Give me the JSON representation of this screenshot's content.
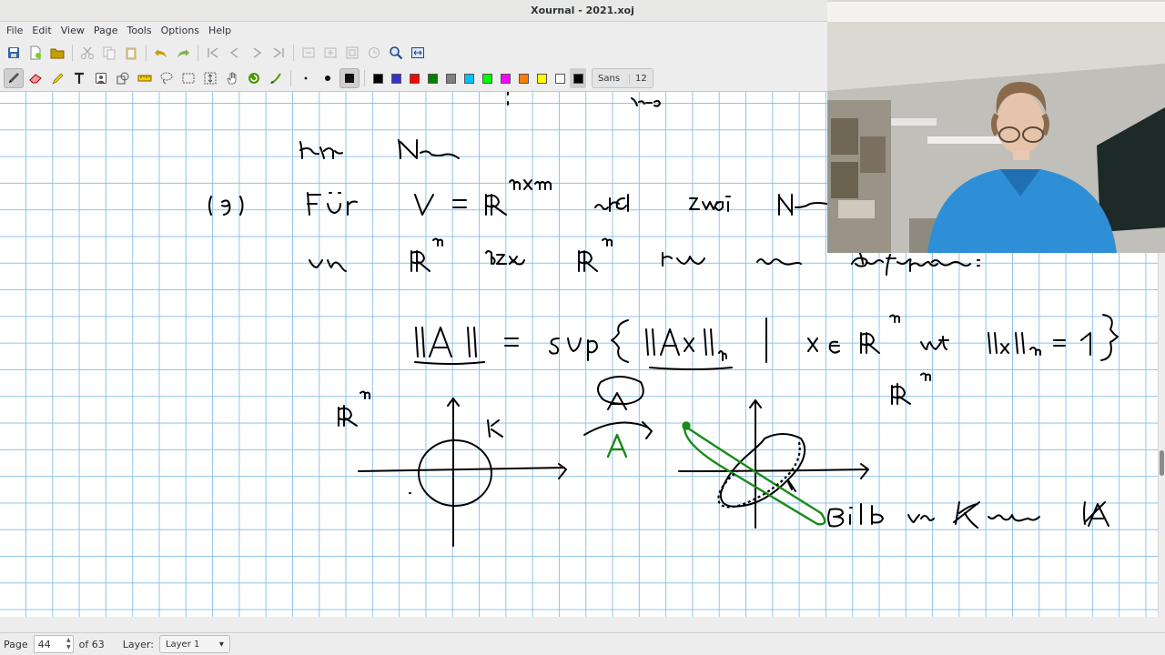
{
  "window": {
    "title": "Xournal - 2021.xoj"
  },
  "menu": [
    "File",
    "Edit",
    "View",
    "Page",
    "Tools",
    "Options",
    "Help"
  ],
  "toolbar1": [
    "save-icon",
    "new-page-icon",
    "open-icon",
    "cut-icon",
    "copy-icon",
    "paste-icon",
    "undo-icon",
    "redo-icon",
    "first-page-icon",
    "previous-page-icon",
    "next-page-icon",
    "last-page-icon",
    "zoom-icons",
    "zoom-fit-icon",
    "fullscreen-icon"
  ],
  "toolbar2": {
    "tools": [
      "pen-icon",
      "eraser-icon",
      "highlighter-icon",
      "text-icon",
      "image-icon",
      "shape-icon",
      "ruler-icon",
      "lasso-select-icon",
      "rect-select-icon",
      "vertical-space-icon",
      "hand-icon",
      "recognizer-icon",
      "default-pen-icon"
    ],
    "colors": [
      "#000000",
      "#3333cc",
      "#ff0000",
      "#008000",
      "#808080",
      "#00c0ff",
      "#00ff00",
      "#ff00ff",
      "#ff8000",
      "#ffff00",
      "#ffffff",
      "#000000"
    ],
    "font_name": "Sans",
    "font_size": "12"
  },
  "status": {
    "page_label": "Page",
    "page_value": "44",
    "page_total": "of 63",
    "layer_label": "Layer:",
    "layer_value": "Layer 1"
  }
}
